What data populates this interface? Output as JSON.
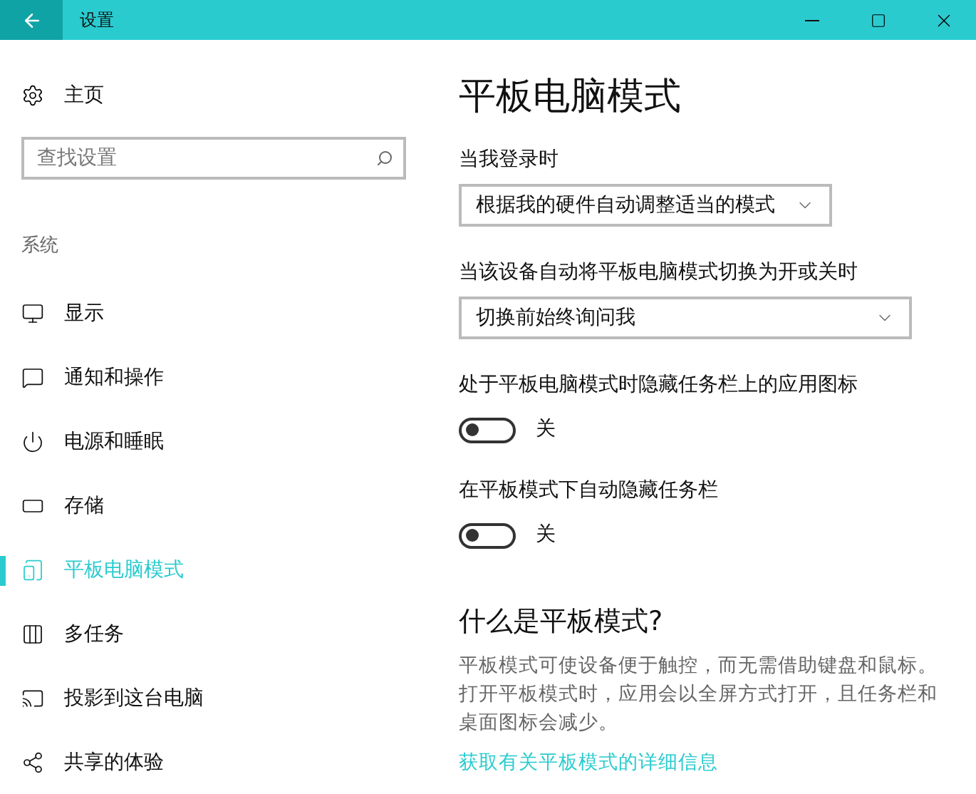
{
  "window": {
    "title": "设置"
  },
  "sidebar": {
    "home": "主页",
    "search": {
      "placeholder": "查找设置"
    },
    "section": "系统",
    "items": [
      {
        "label": "显示",
        "selected": false
      },
      {
        "label": "通知和操作",
        "selected": false
      },
      {
        "label": "电源和睡眠",
        "selected": false
      },
      {
        "label": "存储",
        "selected": false
      },
      {
        "label": "平板电脑模式",
        "selected": true
      },
      {
        "label": "多任务",
        "selected": false
      },
      {
        "label": "投影到这台电脑",
        "selected": false
      },
      {
        "label": "共享的体验",
        "selected": false
      }
    ]
  },
  "page": {
    "title": "平板电脑模式",
    "settings": [
      {
        "kind": "dropdown",
        "label": "当我登录时",
        "value": "根据我的硬件自动调整适当的模式"
      },
      {
        "kind": "dropdown",
        "label": "当该设备自动将平板电脑模式切换为开或关时",
        "value": "切换前始终询问我"
      },
      {
        "kind": "toggle",
        "label": "处于平板电脑模式时隐藏任务栏上的应用图标",
        "on": false,
        "state": "关"
      },
      {
        "kind": "toggle",
        "label": "在平板模式下自动隐藏任务栏",
        "on": false,
        "state": "关"
      }
    ],
    "about": {
      "heading": "什么是平板模式?",
      "text": "平板模式可使设备便于触控，而无需借助键盘和鼠标。打开平板模式时，应用会以全屏方式打开，且任务栏和桌面图标会减少。",
      "link": "获取有关平板模式的详细信息"
    }
  }
}
